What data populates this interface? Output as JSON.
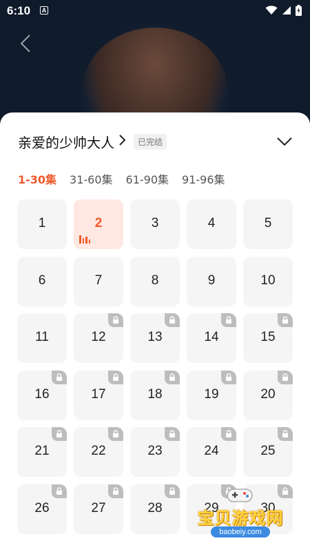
{
  "status_bar": {
    "time": "6:10",
    "app_icon": "A"
  },
  "series": {
    "title": "亲爱的少帅大人",
    "status": "已完结"
  },
  "range_tabs": [
    "1-30集",
    "31-60集",
    "61-90集",
    "91-96集"
  ],
  "active_range_index": 0,
  "episodes": [
    "1",
    "2",
    "3",
    "4",
    "5",
    "6",
    "7",
    "8",
    "9",
    "10",
    "11",
    "12",
    "13",
    "14",
    "15",
    "16",
    "17",
    "18",
    "19",
    "20",
    "21",
    "22",
    "23",
    "24",
    "25",
    "26",
    "27",
    "28",
    "29",
    "30"
  ],
  "current_episode": "2",
  "locked_from_episode": 12,
  "colors": {
    "accent": "#ef5a2c",
    "active_bg": "#ffe8e1",
    "cell_bg": "#f5f5f5",
    "lock_bg": "#bdbdbd"
  },
  "watermark": {
    "text": "宝贝游戏网",
    "url": "baobeiy.com"
  }
}
